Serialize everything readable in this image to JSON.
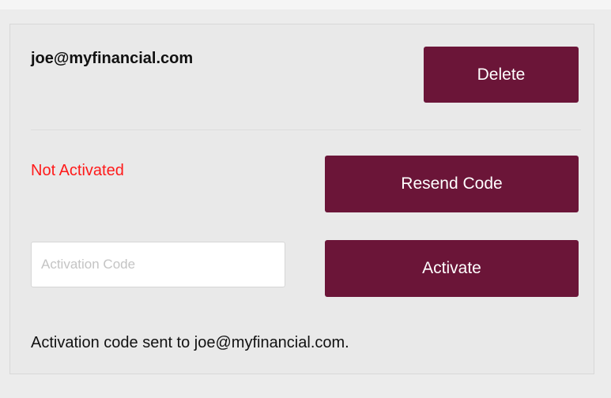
{
  "account": {
    "email": "joe@myfinancial.com",
    "delete_label": "Delete"
  },
  "activation": {
    "status": "Not Activated",
    "status_color": "#ff1a1a",
    "resend_label": "Resend Code",
    "code_placeholder": "Activation Code",
    "code_value": "",
    "activate_label": "Activate",
    "message": "Activation code sent to joe@myfinancial.com."
  },
  "colors": {
    "button_bg": "#6b1538",
    "button_text": "#ffffff",
    "card_bg": "#e9e9e9"
  }
}
